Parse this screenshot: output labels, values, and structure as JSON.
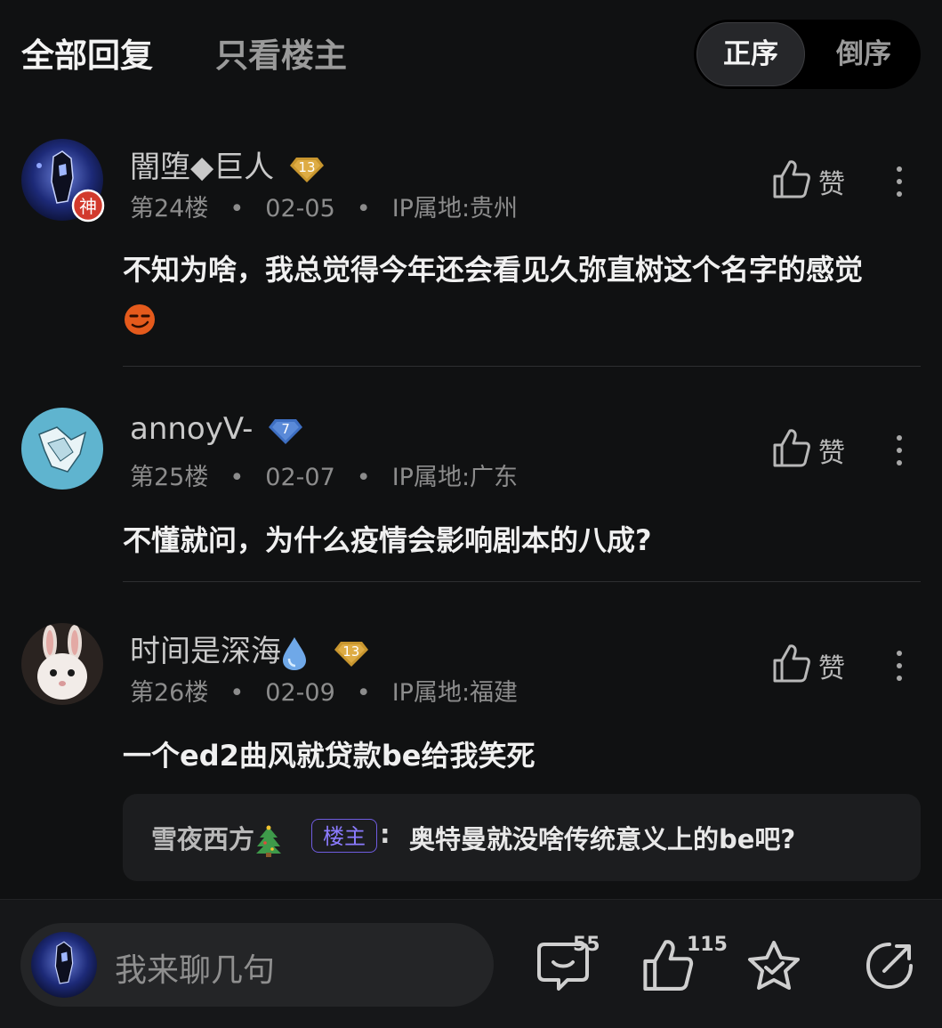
{
  "header": {
    "tab_all": "全部回复",
    "tab_op": "只看楼主",
    "sort_asc": "正序",
    "sort_desc": "倒序"
  },
  "comments": [
    {
      "username": "闇堕◆巨人",
      "level": "13",
      "avatar_badge": "神",
      "floor": "第24楼",
      "date": "02-05",
      "ip": "IP属地:贵州",
      "like_label": "赞",
      "text": "不知为啥，我总觉得今年还会看见久弥直树这个名字的感觉"
    },
    {
      "username": "annoyV-",
      "level": "7",
      "floor": "第25楼",
      "date": "02-07",
      "ip": "IP属地:广东",
      "like_label": "赞",
      "text": "不懂就问，为什么疫情会影响剧本的八成?"
    },
    {
      "username": "时间是深海",
      "level": "13",
      "floor": "第26楼",
      "date": "02-09",
      "ip": "IP属地:福建",
      "like_label": "赞",
      "text": "一个ed2曲风就贷款be给我笑死",
      "reply": {
        "name": "雪夜西方",
        "op_badge": "楼主",
        "colon": ":",
        "text": "奥特曼就没啥传统意义上的be吧?"
      }
    }
  ],
  "bottom_bar": {
    "input_placeholder": "我来聊几句",
    "comment_count": "55",
    "like_count": "115"
  },
  "colors": {
    "background": "#101112",
    "gold_level": "#c8962e",
    "blue_level": "#4d7fd0",
    "op_badge": "#7b6bf0"
  }
}
